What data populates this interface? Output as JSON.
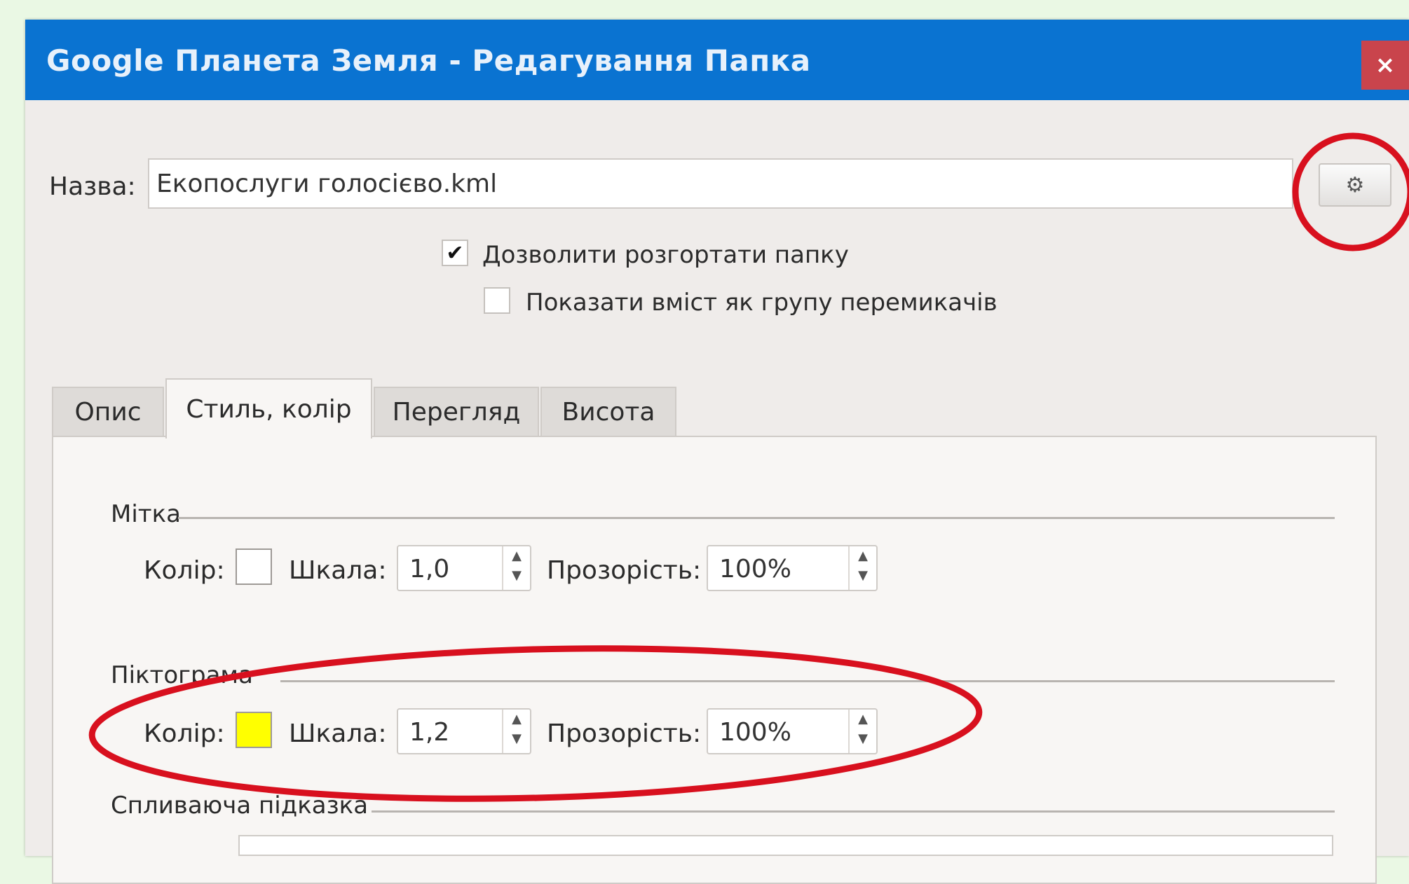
{
  "window": {
    "title": "Google Планета Земля - Редагування Папка",
    "close_label": "×"
  },
  "name_row": {
    "label": "Назва:",
    "value": "Екопослуги голосієво.kml",
    "icon_button_glyph": "⚙",
    "icon_button_icon": "settings-icon"
  },
  "checkboxes": [
    {
      "label": "Дозволити розгортати папку",
      "checked": true,
      "mark": "✔"
    },
    {
      "label": "Показати вміст як групу перемикачів",
      "checked": false,
      "mark": ""
    }
  ],
  "tabs": [
    {
      "label": "Опис",
      "active": false
    },
    {
      "label": "Стиль, колір",
      "active": true
    },
    {
      "label": "Перегляд",
      "active": false
    },
    {
      "label": "Висота",
      "active": false
    }
  ],
  "label_group": {
    "title": "Мітка",
    "color_label": "Колір:",
    "color_value": "#ffffff",
    "scale_label": "Шкала:",
    "scale_value": "1,0",
    "opacity_label": "Прозорість:",
    "opacity_value": "100%"
  },
  "icon_group": {
    "title": "Піктограма",
    "color_label": "Колір:",
    "color_value": "#ffff00",
    "scale_label": "Шкала:",
    "scale_value": "1,2",
    "opacity_label": "Прозорість:",
    "opacity_value": "100%"
  },
  "tooltip_group": {
    "title": "Спливаюча підказка"
  },
  "colors": {
    "titlebar": "#0a73d1",
    "close_button": "#c9444c",
    "annotation": "#d8101e",
    "background": "#eaf8e4"
  }
}
